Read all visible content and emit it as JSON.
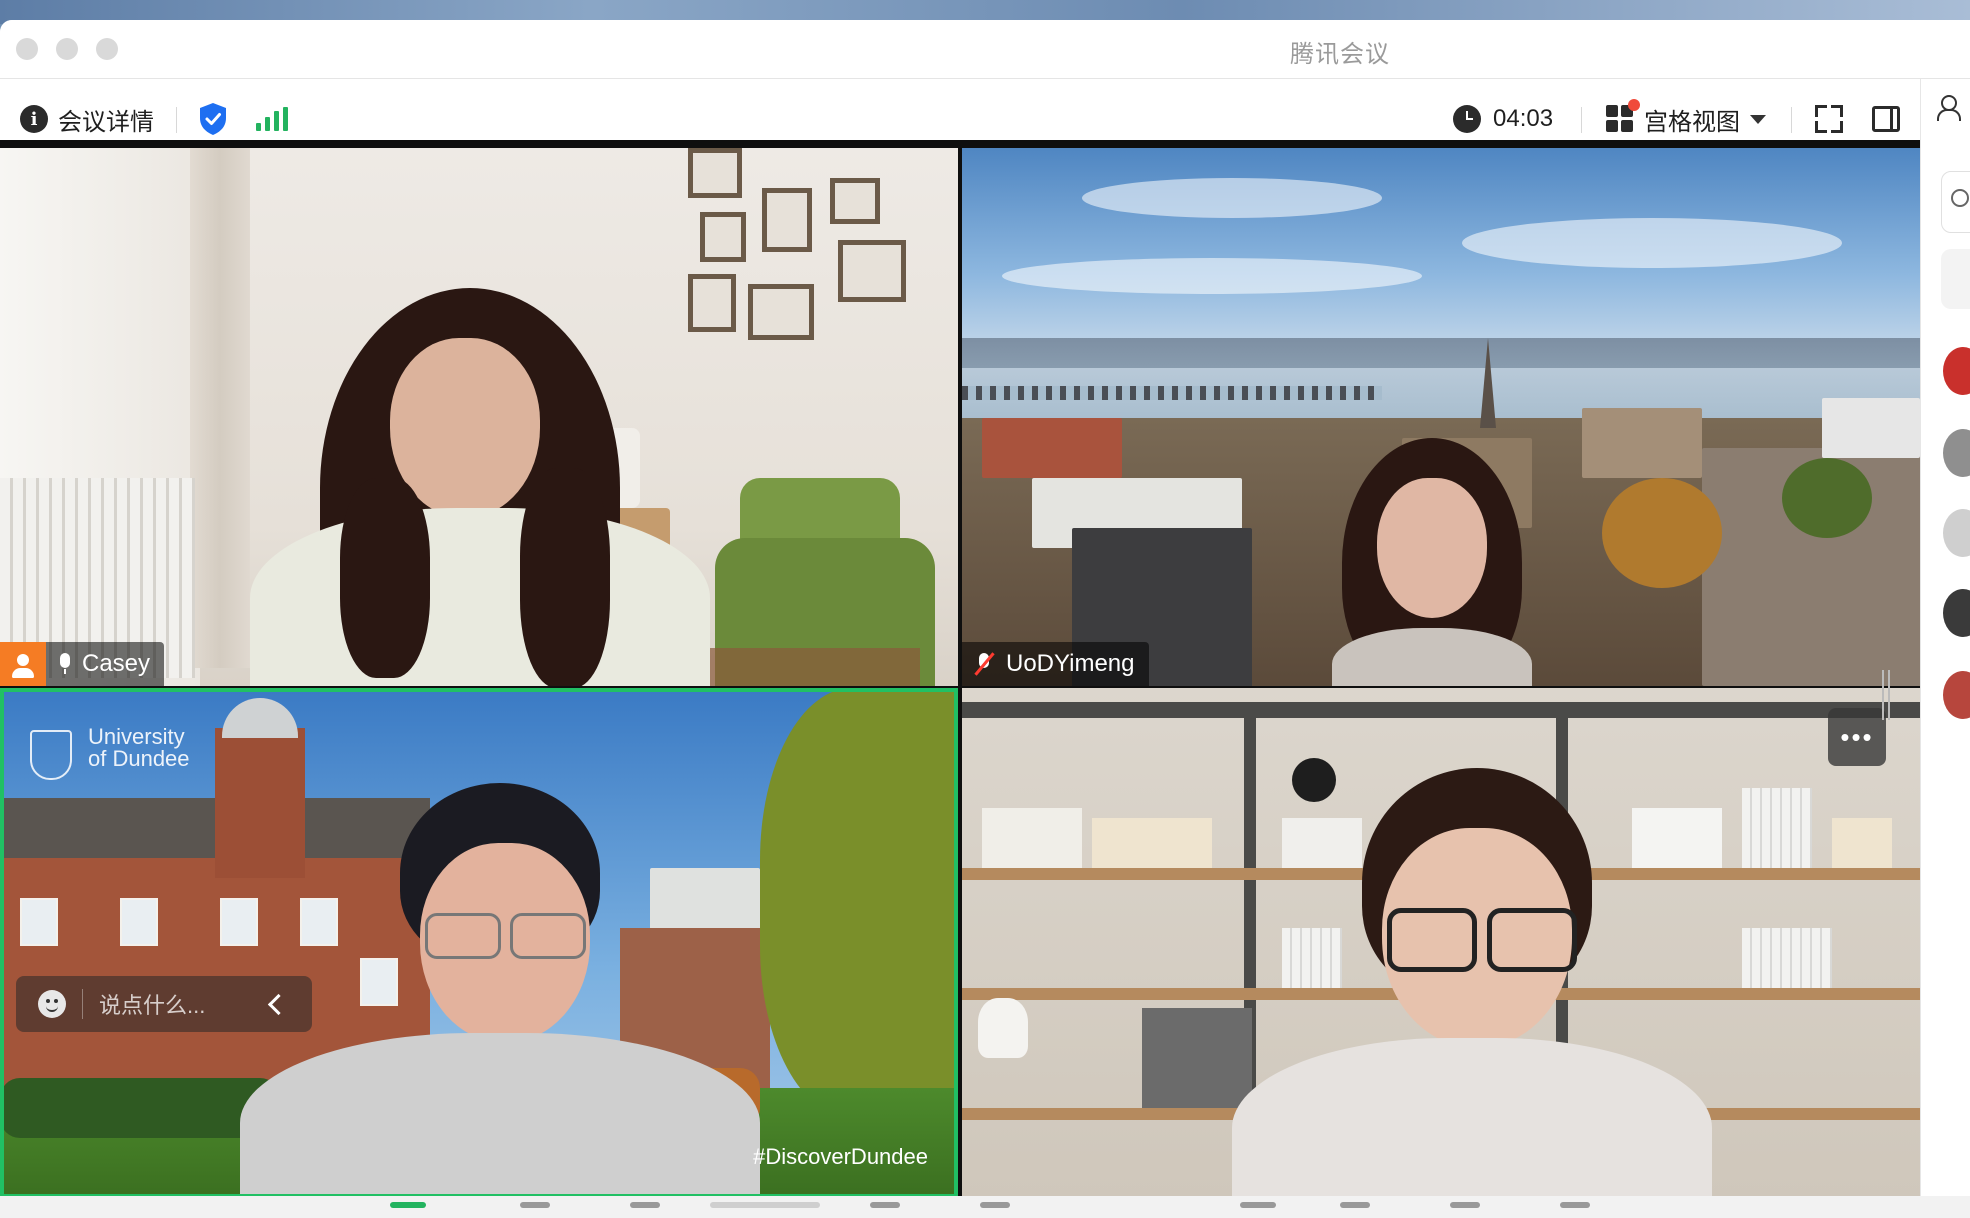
{
  "app": {
    "window_title": "腾讯会议"
  },
  "toolbar": {
    "meeting_details_label": "会议详情",
    "timer": "04:03",
    "view_mode_label": "宫格视图",
    "icons": [
      "info-icon",
      "shield-check-icon",
      "signal-strength-icon",
      "clock-icon",
      "grid-view-icon",
      "fullscreen-icon",
      "side-panel-icon"
    ]
  },
  "participants": [
    {
      "name": "Casey",
      "role": "host",
      "mic": "on"
    },
    {
      "name": "UoDYimeng",
      "mic": "muted"
    },
    {
      "overlay_logo_text": [
        "University",
        "of Dundee"
      ],
      "overlay_hashtag": "#DiscoverDundee",
      "active_speaker": true
    },
    {
      "has_more_button": true
    }
  ],
  "chat": {
    "placeholder": "说点什么..."
  },
  "colors": {
    "active_speaker_border": "#21c064",
    "host_badge": "#f57c24",
    "signal": "#23b35f",
    "shield": "#1e6ff1",
    "muted_slash": "#ff3b30"
  }
}
